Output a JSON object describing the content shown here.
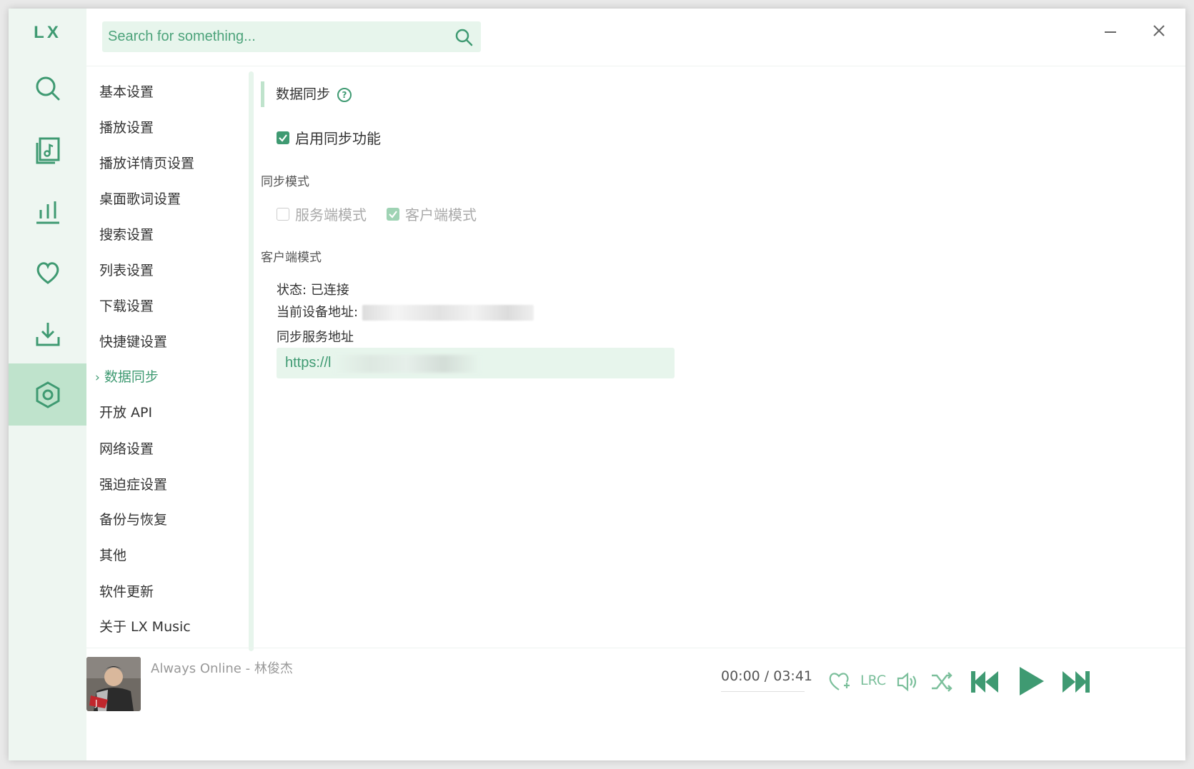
{
  "app": {
    "logo": "LX"
  },
  "search": {
    "placeholder": "Search for something..."
  },
  "nav": {
    "items": [
      "基本设置",
      "播放设置",
      "播放详情页设置",
      "桌面歌词设置",
      "搜索设置",
      "列表设置",
      "下载设置",
      "快捷键设置",
      "数据同步",
      "开放 API",
      "网络设置",
      "强迫症设置",
      "备份与恢复",
      "其他",
      "软件更新",
      "关于 LX Music"
    ],
    "active_index": 8
  },
  "section": {
    "title": "数据同步",
    "enable_label": "启用同步功能",
    "enable_checked": true,
    "mode_heading": "同步模式",
    "mode_server": "服务端模式",
    "mode_client": "客户端模式",
    "client_heading": "客户端模式",
    "status_label": "状态:",
    "status_value": "已连接",
    "device_addr_label": "当前设备地址:",
    "service_addr_label": "同步服务地址",
    "service_addr_value": "https://l"
  },
  "player": {
    "song": "Always Online - 林俊杰",
    "time": "00:00 / 03:41",
    "lrc": "LRC"
  },
  "colors": {
    "accent": "#3f9a72",
    "light": "#e7f5ec",
    "rail": "#eef6f1",
    "active": "#bfe3cc"
  }
}
